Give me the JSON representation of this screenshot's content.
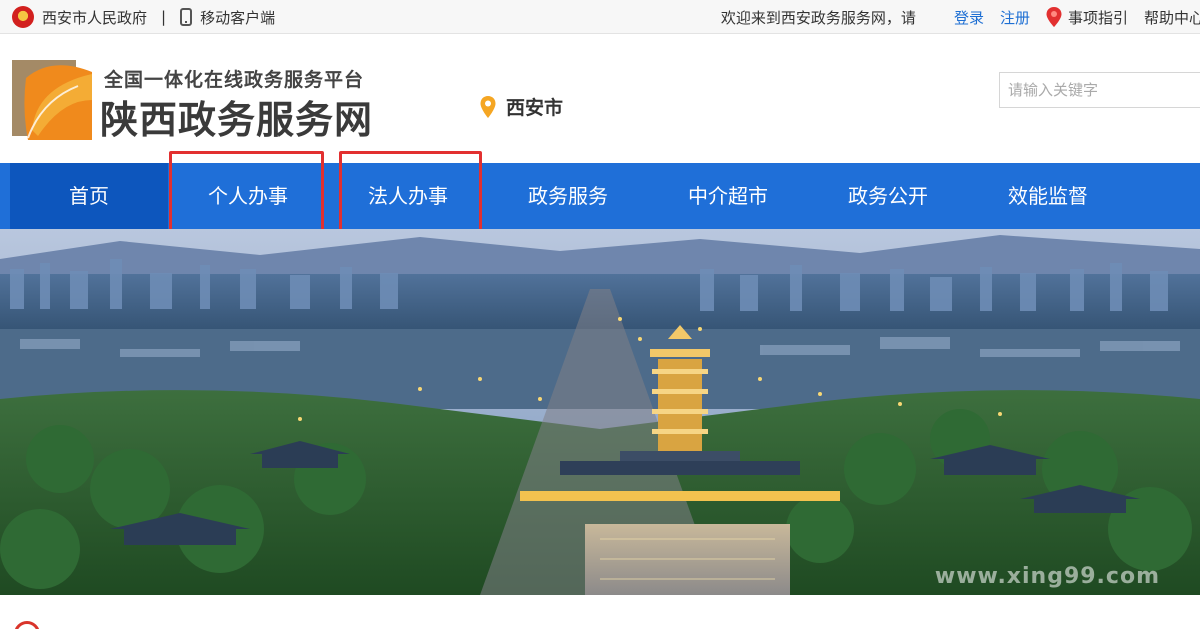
{
  "topbar": {
    "gov_name": "西安市人民政府",
    "separator": "|",
    "mobile_client": "移动客户端",
    "welcome": "欢迎来到西安政务服务网，请",
    "login": "登录",
    "register": "注册",
    "guide": "事项指引",
    "help": "帮助中心"
  },
  "header": {
    "slogan": "全国一体化在线政务服务平台",
    "site_name": "陕西政务服务网",
    "city": "西安市"
  },
  "search": {
    "placeholder": "请输入关键字"
  },
  "nav": {
    "items": [
      {
        "label": "首页"
      },
      {
        "label": "个人办事"
      },
      {
        "label": "法人办事"
      },
      {
        "label": "政务服务"
      },
      {
        "label": "中介超市"
      },
      {
        "label": "政务公开"
      },
      {
        "label": "效能监督"
      }
    ]
  },
  "banner": {
    "watermark": "www.xing99.com"
  },
  "colors": {
    "nav_blue": "#1f6fd8",
    "nav_active": "#0d56bd",
    "link_blue": "#1e6fd3",
    "highlight_red": "#e23030"
  }
}
